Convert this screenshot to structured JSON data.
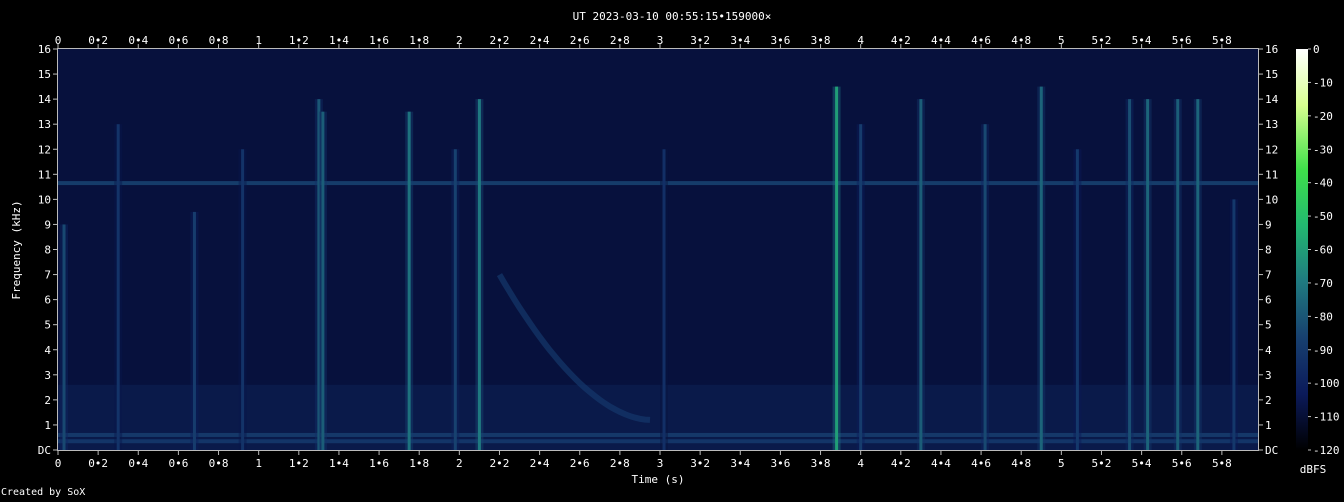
{
  "chart_data": {
    "type": "heatmap",
    "title": "UT 2023-03-10 00:55:15•159000×",
    "xlabel": "Time (s)",
    "ylabel": "Frequency (kHz)",
    "xlim": [
      0,
      5.98
    ],
    "ylim": [
      0,
      16
    ],
    "x_ticks": [
      "0",
      "0•2",
      "0•4",
      "0•6",
      "0•8",
      "1",
      "1•2",
      "1•4",
      "1•6",
      "1•8",
      "2",
      "2•2",
      "2•4",
      "2•6",
      "2•8",
      "3",
      "3•2",
      "3•4",
      "3•6",
      "3•8",
      "4",
      "4•2",
      "4•4",
      "4•6",
      "4•8",
      "5",
      "5•2",
      "5•4",
      "5•6",
      "5•8"
    ],
    "y_ticks": [
      "DC",
      "1",
      "2",
      "3",
      "4",
      "5",
      "6",
      "7",
      "8",
      "9",
      "10",
      "11",
      "12",
      "13",
      "14",
      "15",
      "16"
    ],
    "colorbar": {
      "label": "dBFS",
      "ticks": [
        "0",
        "-10",
        "-20",
        "-30",
        "-40",
        "-50",
        "-60",
        "-70",
        "-80",
        "-90",
        "-100",
        "-110",
        "-120"
      ],
      "range": [
        -120,
        0
      ],
      "colors": [
        "#000000",
        "#0b1a5a",
        "#17406f",
        "#1f7a80",
        "#22b870",
        "#3fe04a",
        "#d8ff90",
        "#ffffff"
      ]
    },
    "noise_floor_dbfs": -102,
    "tone_lines": [
      {
        "freq_khz": 10.65,
        "dbfs": -86
      },
      {
        "freq_khz": 0.6,
        "dbfs": -88
      },
      {
        "freq_khz": 0.35,
        "dbfs": -90
      }
    ],
    "impulses": [
      {
        "t": 0.03,
        "f_top": 9,
        "dbfs": -84
      },
      {
        "t": 0.3,
        "f_top": 13,
        "dbfs": -92
      },
      {
        "t": 0.68,
        "f_top": 9.5,
        "dbfs": -88
      },
      {
        "t": 0.92,
        "f_top": 12,
        "dbfs": -92
      },
      {
        "t": 1.3,
        "f_top": 14,
        "dbfs": -80
      },
      {
        "t": 1.32,
        "f_top": 13.5,
        "dbfs": -78
      },
      {
        "t": 1.75,
        "f_top": 13.5,
        "dbfs": -72
      },
      {
        "t": 1.98,
        "f_top": 12,
        "dbfs": -86
      },
      {
        "t": 2.1,
        "f_top": 14,
        "dbfs": -70
      },
      {
        "t": 3.02,
        "f_top": 12,
        "dbfs": -94
      },
      {
        "t": 3.88,
        "f_top": 14.5,
        "dbfs": -60
      },
      {
        "t": 4.0,
        "f_top": 13,
        "dbfs": -88
      },
      {
        "t": 4.3,
        "f_top": 14,
        "dbfs": -78
      },
      {
        "t": 4.62,
        "f_top": 13,
        "dbfs": -84
      },
      {
        "t": 4.9,
        "f_top": 14.5,
        "dbfs": -76
      },
      {
        "t": 5.08,
        "f_top": 12,
        "dbfs": -90
      },
      {
        "t": 5.34,
        "f_top": 14,
        "dbfs": -82
      },
      {
        "t": 5.43,
        "f_top": 14,
        "dbfs": -76
      },
      {
        "t": 5.58,
        "f_top": 14,
        "dbfs": -78
      },
      {
        "t": 5.68,
        "f_top": 14,
        "dbfs": -76
      },
      {
        "t": 5.86,
        "f_top": 10,
        "dbfs": -90
      }
    ],
    "sweep": {
      "t_start": 2.2,
      "f_start_khz": 7,
      "t_end": 2.95,
      "f_end_khz": 1.2,
      "dbfs": -90
    }
  },
  "footer": {
    "credit": "Created by SoX"
  }
}
